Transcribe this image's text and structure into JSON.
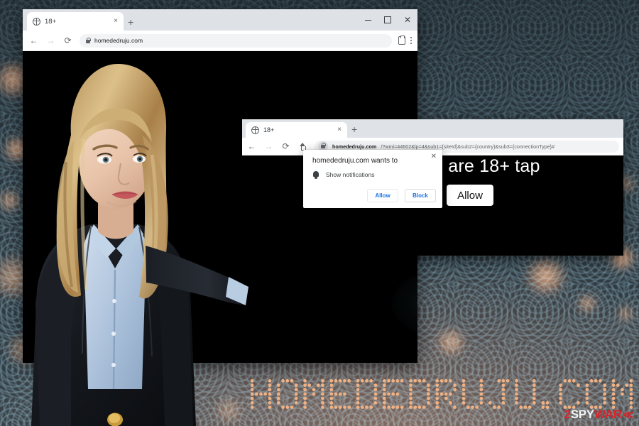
{
  "background": {
    "pattern_name": "concentric-arc-wallpaper",
    "base_color": "#333e46",
    "bokeh_color": "#ff9f5e"
  },
  "outer_browser": {
    "name": "chrome-window-outer",
    "tab": {
      "favicon": "globe-icon",
      "title": "18+",
      "close_label": "×"
    },
    "new_tab_label": "+",
    "window_controls": {
      "minimize": "–",
      "maximize": "□",
      "close": "✕"
    },
    "toolbar": {
      "back": "←",
      "forward": "→",
      "reload": "⟳",
      "url": "homededruju.com",
      "lock": "lock-icon",
      "profile": "profile-icon",
      "menu": "kebab-menu-icon"
    }
  },
  "inner_browser": {
    "name": "chrome-window-inner",
    "tab": {
      "favicon": "globe-icon",
      "title": "18+",
      "close_label": "×"
    },
    "new_tab_label": "+",
    "toolbar": {
      "back": "←",
      "forward": "→",
      "reload": "⟳",
      "home": "home-icon",
      "url_origin": "homededruju.com",
      "url_rest": "/?wmi=44602&lp=4&sub1={siteId}&sub2={country}&sub3={connectionType}#"
    },
    "page": {
      "headline": "u are 18+ tap",
      "allow_button": "Allow"
    }
  },
  "notification_dialog": {
    "name": "chrome-permission-prompt",
    "title": "homededruju.com wants to",
    "permission": "Show notifications",
    "permission_icon": "bell-icon",
    "allow_button": "Allow",
    "block_button": "Block",
    "close_label": "✕",
    "accent_color": "#1a73e8"
  },
  "person": {
    "name": "presenter-woman",
    "description": "blonde woman in black blazer and light blue shirt gesturing toward the browser"
  },
  "logo": {
    "text": "HOMEDEDRUJU.COM",
    "style": "led-dot-matrix",
    "dot_color": "#f0b183"
  },
  "watermark": {
    "part1": "2",
    "part2": "SPY",
    "part3": "WAR",
    "chevron": "≪",
    "red": "#d8232a",
    "white": "#f4f4f4"
  }
}
